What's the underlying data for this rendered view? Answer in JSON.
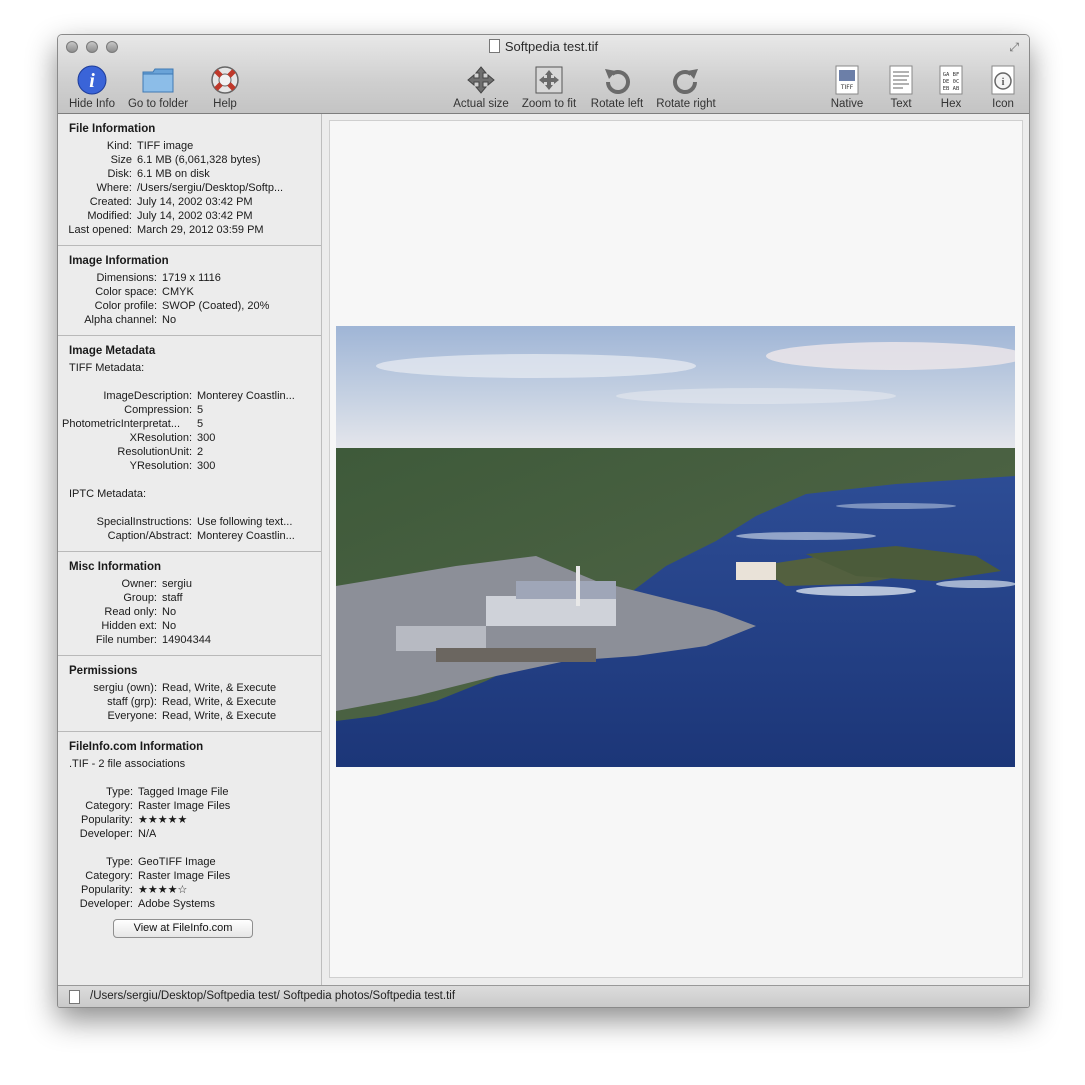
{
  "window": {
    "title": "Softpedia test.tif"
  },
  "toolbar": {
    "hide_info": "Hide Info",
    "go_to_folder": "Go to folder",
    "help": "Help",
    "actual_size": "Actual size",
    "zoom_to_fit": "Zoom to fit",
    "rotate_left": "Rotate left",
    "rotate_right": "Rotate right",
    "native": "Native",
    "text": "Text",
    "hex": "Hex",
    "icon": "Icon",
    "native_badge": "TIFF",
    "hex_badge": "GA BF DE 0C EB AB"
  },
  "file_info": {
    "title": "File Information",
    "rows": [
      {
        "k": "Kind:",
        "v": "TIFF image"
      },
      {
        "k": "Size",
        "v": "6.1 MB (6,061,328 bytes)"
      },
      {
        "k": "Disk:",
        "v": "6.1 MB on disk"
      },
      {
        "k": "Where:",
        "v": "/Users/sergiu/Desktop/Softp..."
      },
      {
        "k": "Created:",
        "v": "July 14, 2002 03:42 PM"
      },
      {
        "k": "Modified:",
        "v": "July 14, 2002 03:42 PM"
      },
      {
        "k": "Last opened:",
        "v": "March 29, 2012 03:59 PM"
      }
    ]
  },
  "image_info": {
    "title": "Image Information",
    "rows": [
      {
        "k": "Dimensions:",
        "v": "1719 x 1116"
      },
      {
        "k": "Color space:",
        "v": "CMYK"
      },
      {
        "k": "Color profile:",
        "v": "SWOP (Coated), 20%"
      },
      {
        "k": "Alpha channel:",
        "v": "No"
      }
    ]
  },
  "metadata": {
    "title": "Image Metadata",
    "tiff_label": "TIFF Metadata:",
    "tiff_rows": [
      {
        "k": "ImageDescription:",
        "v": "Monterey Coastlin..."
      },
      {
        "k": "Compression:",
        "v": "5"
      },
      {
        "k": "PhotometricInterpretat...",
        "v": "5"
      },
      {
        "k": "XResolution:",
        "v": "300"
      },
      {
        "k": "ResolutionUnit:",
        "v": "2"
      },
      {
        "k": "YResolution:",
        "v": "300"
      }
    ],
    "iptc_label": "IPTC Metadata:",
    "iptc_rows": [
      {
        "k": "SpecialInstructions:",
        "v": "Use following text..."
      },
      {
        "k": "Caption/Abstract:",
        "v": "Monterey Coastlin..."
      }
    ]
  },
  "misc": {
    "title": "Misc Information",
    "rows": [
      {
        "k": "Owner:",
        "v": "sergiu"
      },
      {
        "k": "Group:",
        "v": "staff"
      },
      {
        "k": "Read only:",
        "v": "No"
      },
      {
        "k": "Hidden ext:",
        "v": "No"
      },
      {
        "k": "File number:",
        "v": "14904344"
      }
    ]
  },
  "permissions": {
    "title": "Permissions",
    "rows": [
      {
        "k": "sergiu (own):",
        "v": "Read, Write, & Execute"
      },
      {
        "k": "staff (grp):",
        "v": "Read, Write, & Execute"
      },
      {
        "k": "Everyone:",
        "v": "Read, Write, & Execute"
      }
    ]
  },
  "fileinfo": {
    "title": "FileInfo.com Information",
    "assoc": ".TIF - 2 file associations",
    "entries": [
      {
        "type_k": "Type:",
        "type": "Tagged Image File",
        "cat_k": "Category:",
        "category": "Raster Image Files",
        "pop_k": "Popularity:",
        "popularity": "★★★★★",
        "dev_k": "Developer:",
        "developer": "N/A"
      },
      {
        "type_k": "Type:",
        "type": "GeoTIFF Image",
        "cat_k": "Category:",
        "category": "Raster Image Files",
        "pop_k": "Popularity:",
        "popularity": "★★★★☆",
        "dev_k": "Developer:",
        "developer": "Adobe Systems"
      }
    ],
    "button": "View at FileInfo.com"
  },
  "status": {
    "path": "/Users/sergiu/Desktop/Softpedia test/ Softpedia photos/Softpedia test.tif"
  },
  "colors": {
    "sky": "#b9c8dc",
    "sea": "#2a4a92",
    "panel": "#ececec"
  },
  "icons": [
    "info-icon",
    "folder-icon",
    "lifebuoy-icon",
    "move-arrows-icon",
    "zoom-fit-icon",
    "rotate-left-icon",
    "rotate-right-icon",
    "native-doc-icon",
    "text-doc-icon",
    "hex-doc-icon",
    "info-doc-icon"
  ]
}
